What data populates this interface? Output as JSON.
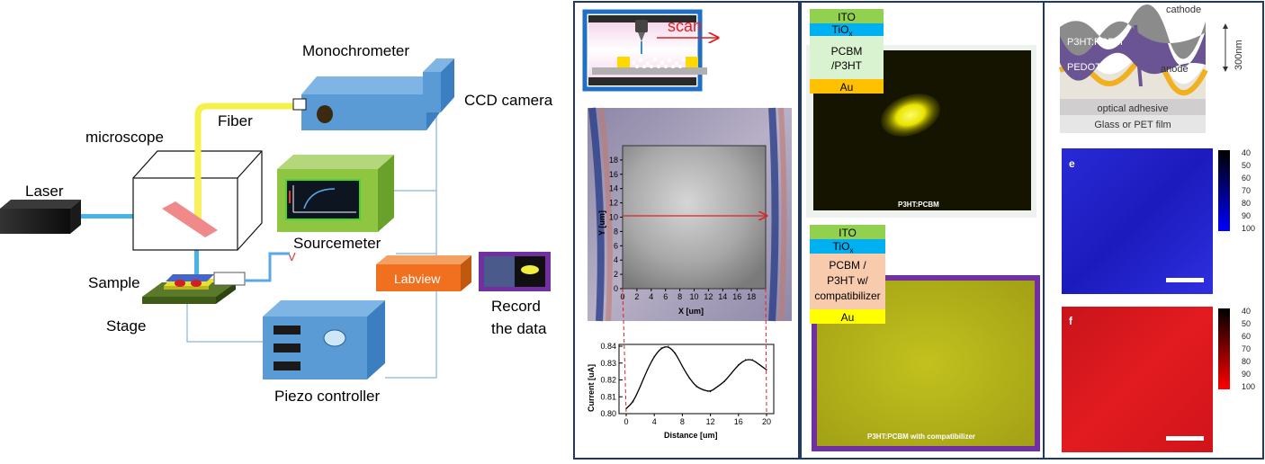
{
  "setup": {
    "laser": "Laser",
    "microscope": "microscope",
    "fiber": "Fiber",
    "monochrometer": "Monochrometer",
    "ccd_camera": "CCD camera",
    "sourcemeter": "Sourcemeter",
    "voltage_symbol": "V",
    "sample": "Sample",
    "stage": "Stage",
    "labview": "Labview",
    "record_line1": "Record",
    "record_line2": "the data",
    "piezo_controller": "Piezo controller"
  },
  "scan_panel": {
    "scan_label": "scan",
    "y_axis_label": "Y [um]",
    "x_axis_label": "X [um]",
    "y_ticks": [
      "0",
      "2",
      "4",
      "6",
      "8",
      "10",
      "12",
      "14",
      "16",
      "18"
    ],
    "x_ticks": [
      "0",
      "2",
      "4",
      "6",
      "8",
      "10",
      "12",
      "14",
      "16",
      "18"
    ],
    "profile_ylabel": "Current [uA]",
    "profile_xlabel": "Distance [um]",
    "profile_y_ticks": [
      "0.80",
      "0.81",
      "0.82",
      "0.83",
      "0.84"
    ],
    "profile_x_ticks": [
      "0",
      "4",
      "8",
      "12",
      "16",
      "20"
    ]
  },
  "chart_data": {
    "type": "line",
    "xlabel": "Distance [um]",
    "ylabel": "Current [uA]",
    "xlim": [
      0,
      20
    ],
    "ylim": [
      0.8,
      0.84
    ],
    "series": [
      {
        "x": [
          0,
          1,
          2,
          3,
          4,
          5,
          6,
          7,
          8,
          9,
          10,
          11,
          12,
          13,
          14,
          15,
          16,
          17,
          18,
          19,
          20
        ],
        "values": [
          0.803,
          0.807,
          0.816,
          0.826,
          0.834,
          0.839,
          0.84,
          0.836,
          0.828,
          0.821,
          0.816,
          0.814,
          0.813,
          0.816,
          0.819,
          0.824,
          0.829,
          0.832,
          0.832,
          0.829,
          0.826
        ]
      }
    ]
  },
  "device_top": {
    "ito": "ITO",
    "tiox": "TiO",
    "tiox_sub": "x",
    "active_line1": "PCBM",
    "active_line2": "/P3HT",
    "au": "Au",
    "caption": "P3HT:PCBM"
  },
  "device_bottom": {
    "ito": "ITO",
    "tiox": "TiO",
    "tiox_sub": "x",
    "active_line1": "PCBM /",
    "active_line2": "P3HT w/",
    "active_line3": "compatibilizer",
    "au": "Au",
    "caption": "P3HT:PCBM with compatibilizer"
  },
  "cross_section": {
    "cathode": "cathode",
    "p3ht_pcbm": "P3HT:PCBM",
    "pedot": "PEDOT:PSS",
    "anode": "anode",
    "thickness": "300nm",
    "adhesive": "optical adhesive",
    "substrate": "Glass or PET film"
  },
  "map_e": {
    "letter": "e",
    "scale": [
      "40",
      "50",
      "60",
      "70",
      "80",
      "90",
      "100"
    ]
  },
  "map_f": {
    "letter": "f",
    "scale": [
      "40",
      "50",
      "60",
      "70",
      "80",
      "90",
      "100"
    ]
  }
}
